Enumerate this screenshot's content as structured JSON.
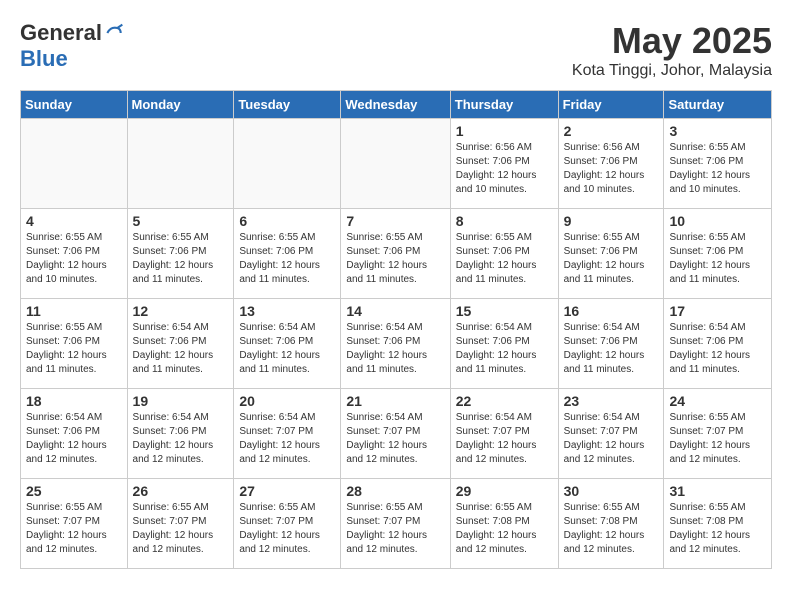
{
  "logo": {
    "general": "General",
    "blue": "Blue"
  },
  "title": "May 2025",
  "location": "Kota Tinggi, Johor, Malaysia",
  "days_of_week": [
    "Sunday",
    "Monday",
    "Tuesday",
    "Wednesday",
    "Thursday",
    "Friday",
    "Saturday"
  ],
  "weeks": [
    [
      {
        "day": "",
        "info": ""
      },
      {
        "day": "",
        "info": ""
      },
      {
        "day": "",
        "info": ""
      },
      {
        "day": "",
        "info": ""
      },
      {
        "day": "1",
        "info": "Sunrise: 6:56 AM\nSunset: 7:06 PM\nDaylight: 12 hours\nand 10 minutes."
      },
      {
        "day": "2",
        "info": "Sunrise: 6:56 AM\nSunset: 7:06 PM\nDaylight: 12 hours\nand 10 minutes."
      },
      {
        "day": "3",
        "info": "Sunrise: 6:55 AM\nSunset: 7:06 PM\nDaylight: 12 hours\nand 10 minutes."
      }
    ],
    [
      {
        "day": "4",
        "info": "Sunrise: 6:55 AM\nSunset: 7:06 PM\nDaylight: 12 hours\nand 10 minutes."
      },
      {
        "day": "5",
        "info": "Sunrise: 6:55 AM\nSunset: 7:06 PM\nDaylight: 12 hours\nand 11 minutes."
      },
      {
        "day": "6",
        "info": "Sunrise: 6:55 AM\nSunset: 7:06 PM\nDaylight: 12 hours\nand 11 minutes."
      },
      {
        "day": "7",
        "info": "Sunrise: 6:55 AM\nSunset: 7:06 PM\nDaylight: 12 hours\nand 11 minutes."
      },
      {
        "day": "8",
        "info": "Sunrise: 6:55 AM\nSunset: 7:06 PM\nDaylight: 12 hours\nand 11 minutes."
      },
      {
        "day": "9",
        "info": "Sunrise: 6:55 AM\nSunset: 7:06 PM\nDaylight: 12 hours\nand 11 minutes."
      },
      {
        "day": "10",
        "info": "Sunrise: 6:55 AM\nSunset: 7:06 PM\nDaylight: 12 hours\nand 11 minutes."
      }
    ],
    [
      {
        "day": "11",
        "info": "Sunrise: 6:55 AM\nSunset: 7:06 PM\nDaylight: 12 hours\nand 11 minutes."
      },
      {
        "day": "12",
        "info": "Sunrise: 6:54 AM\nSunset: 7:06 PM\nDaylight: 12 hours\nand 11 minutes."
      },
      {
        "day": "13",
        "info": "Sunrise: 6:54 AM\nSunset: 7:06 PM\nDaylight: 12 hours\nand 11 minutes."
      },
      {
        "day": "14",
        "info": "Sunrise: 6:54 AM\nSunset: 7:06 PM\nDaylight: 12 hours\nand 11 minutes."
      },
      {
        "day": "15",
        "info": "Sunrise: 6:54 AM\nSunset: 7:06 PM\nDaylight: 12 hours\nand 11 minutes."
      },
      {
        "day": "16",
        "info": "Sunrise: 6:54 AM\nSunset: 7:06 PM\nDaylight: 12 hours\nand 11 minutes."
      },
      {
        "day": "17",
        "info": "Sunrise: 6:54 AM\nSunset: 7:06 PM\nDaylight: 12 hours\nand 11 minutes."
      }
    ],
    [
      {
        "day": "18",
        "info": "Sunrise: 6:54 AM\nSunset: 7:06 PM\nDaylight: 12 hours\nand 12 minutes."
      },
      {
        "day": "19",
        "info": "Sunrise: 6:54 AM\nSunset: 7:06 PM\nDaylight: 12 hours\nand 12 minutes."
      },
      {
        "day": "20",
        "info": "Sunrise: 6:54 AM\nSunset: 7:07 PM\nDaylight: 12 hours\nand 12 minutes."
      },
      {
        "day": "21",
        "info": "Sunrise: 6:54 AM\nSunset: 7:07 PM\nDaylight: 12 hours\nand 12 minutes."
      },
      {
        "day": "22",
        "info": "Sunrise: 6:54 AM\nSunset: 7:07 PM\nDaylight: 12 hours\nand 12 minutes."
      },
      {
        "day": "23",
        "info": "Sunrise: 6:54 AM\nSunset: 7:07 PM\nDaylight: 12 hours\nand 12 minutes."
      },
      {
        "day": "24",
        "info": "Sunrise: 6:55 AM\nSunset: 7:07 PM\nDaylight: 12 hours\nand 12 minutes."
      }
    ],
    [
      {
        "day": "25",
        "info": "Sunrise: 6:55 AM\nSunset: 7:07 PM\nDaylight: 12 hours\nand 12 minutes."
      },
      {
        "day": "26",
        "info": "Sunrise: 6:55 AM\nSunset: 7:07 PM\nDaylight: 12 hours\nand 12 minutes."
      },
      {
        "day": "27",
        "info": "Sunrise: 6:55 AM\nSunset: 7:07 PM\nDaylight: 12 hours\nand 12 minutes."
      },
      {
        "day": "28",
        "info": "Sunrise: 6:55 AM\nSunset: 7:07 PM\nDaylight: 12 hours\nand 12 minutes."
      },
      {
        "day": "29",
        "info": "Sunrise: 6:55 AM\nSunset: 7:08 PM\nDaylight: 12 hours\nand 12 minutes."
      },
      {
        "day": "30",
        "info": "Sunrise: 6:55 AM\nSunset: 7:08 PM\nDaylight: 12 hours\nand 12 minutes."
      },
      {
        "day": "31",
        "info": "Sunrise: 6:55 AM\nSunset: 7:08 PM\nDaylight: 12 hours\nand 12 minutes."
      }
    ]
  ]
}
